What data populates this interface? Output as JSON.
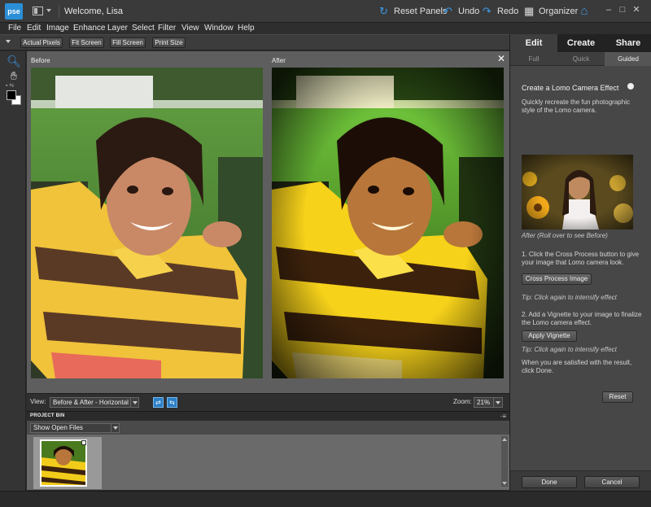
{
  "app": {
    "logo_text": "pse",
    "welcome": "Welcome, Lisa",
    "actions": {
      "reset_panels": "Reset Panels",
      "undo": "Undo",
      "redo": "Redo",
      "organizer": "Organizer"
    },
    "icons": [
      "workspace-icon",
      "reset-panels-icon",
      "undo-icon",
      "redo-icon",
      "organizer-icon",
      "home-icon",
      "minimize-icon",
      "maximize-icon",
      "close-icon"
    ]
  },
  "menu": [
    "File",
    "Edit",
    "Image",
    "Enhance",
    "Layer",
    "Select",
    "Filter",
    "View",
    "Window",
    "Help"
  ],
  "options_bar": {
    "actual_pixels": "Actual Pixels",
    "fit_screen": "Fit Screen",
    "fill_screen": "Fill Screen",
    "print_size": "Print Size"
  },
  "canvas": {
    "before_label": "Before",
    "after_label": "After",
    "close_glyph": "✕"
  },
  "view_bar": {
    "label": "View:",
    "mode": "Before & After - Horizontal",
    "zoom_label": "Zoom:",
    "zoom_value": "21%"
  },
  "project_bin": {
    "title": "PROJECT BIN",
    "menu_glyph": "·≡",
    "filter": "Show Open Files"
  },
  "panel": {
    "tabs": [
      "Edit",
      "Create",
      "Share"
    ],
    "subtabs": [
      "Full",
      "Quick",
      "Guided"
    ],
    "guided": {
      "title": "Create a Lomo Camera Effect",
      "intro": "Quickly recreate the fun photographic style of the Lomo camera.",
      "caption": "After (Roll over to see Before)",
      "step1": "1. Click the Cross Process button to give your image that Lomo camera look.",
      "cross_process_button": "Cross Process Image",
      "tip1": "Tip: Click again to intensify effect",
      "step2": "2. Add a Vignette to your image to finalize the Lomo camera effect.",
      "vignette_button": "Apply Vignette",
      "tip2": "Tip: Click again to intensify effect",
      "finish": "When you are satisfied with the result, click Done.",
      "reset_button": "Reset"
    },
    "done": "Done",
    "cancel": "Cancel"
  },
  "colors": {
    "accent": "#3d9be9",
    "logo": "#2a8fd6"
  }
}
